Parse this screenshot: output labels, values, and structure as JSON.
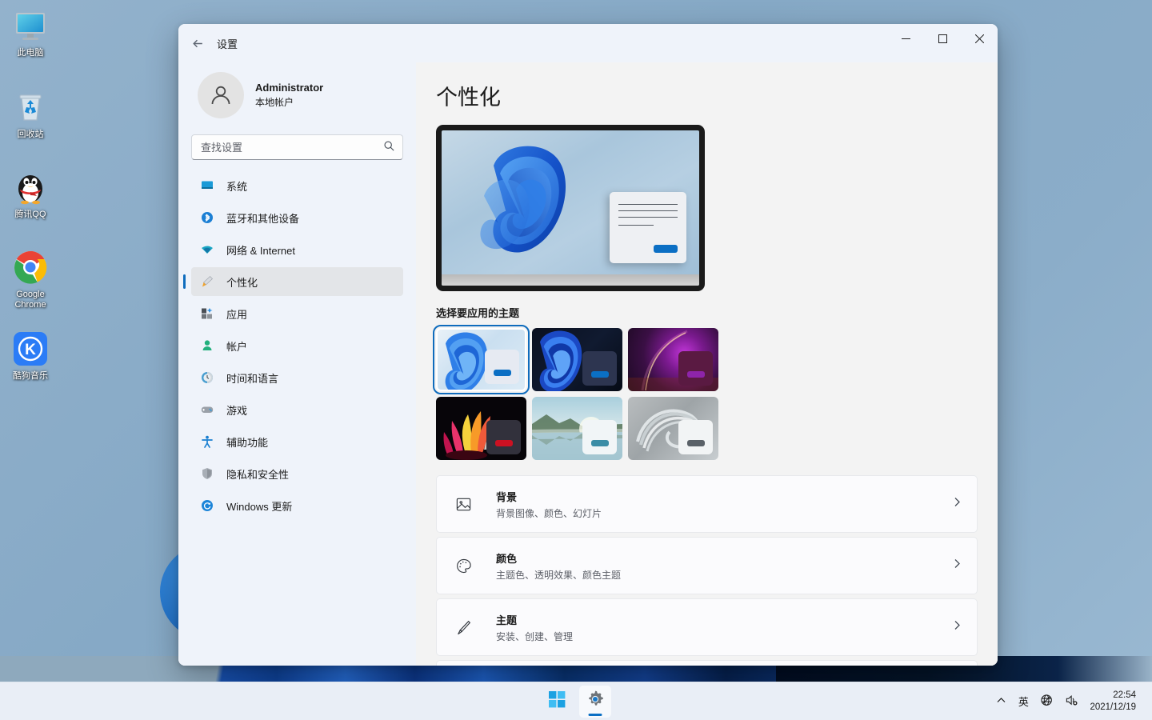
{
  "desktop": {
    "icons": [
      {
        "name": "this-pc",
        "label": "此电脑",
        "icon": "monitor-icon"
      },
      {
        "name": "recycle-bin",
        "label": "回收站",
        "icon": "recycle-bin-icon"
      },
      {
        "name": "tencent-qq",
        "label": "腾讯QQ",
        "icon": "qq-penguin-icon"
      },
      {
        "name": "google-chrome",
        "label": "Google Chrome",
        "icon": "chrome-icon"
      },
      {
        "name": "kugou-music",
        "label": "酷狗音乐",
        "icon": "kugou-k-icon"
      }
    ]
  },
  "window": {
    "title": "设置",
    "back_icon": "back-arrow-icon",
    "controls": {
      "minimize": "–",
      "maximize": "□",
      "close": "✕"
    }
  },
  "sidebar": {
    "account": {
      "name": "Administrator",
      "subtitle": "本地帐户",
      "avatar_icon": "person-avatar-icon"
    },
    "search": {
      "placeholder": "查找设置",
      "value": "",
      "icon": "search-icon"
    },
    "items": [
      {
        "label": "系统",
        "icon": "system-monitor-icon",
        "active": false
      },
      {
        "label": "蓝牙和其他设备",
        "icon": "bluetooth-icon",
        "active": false
      },
      {
        "label": "网络 & Internet",
        "icon": "wifi-icon",
        "active": false
      },
      {
        "label": "个性化",
        "icon": "paintbrush-icon",
        "active": true
      },
      {
        "label": "应用",
        "icon": "apps-icon",
        "active": false
      },
      {
        "label": "帐户",
        "icon": "account-person-icon",
        "active": false
      },
      {
        "label": "时间和语言",
        "icon": "clock-globe-icon",
        "active": false
      },
      {
        "label": "游戏",
        "icon": "gamepad-icon",
        "active": false
      },
      {
        "label": "辅助功能",
        "icon": "accessibility-icon",
        "active": false
      },
      {
        "label": "隐私和安全性",
        "icon": "shield-icon",
        "active": false
      },
      {
        "label": "Windows 更新",
        "icon": "update-refresh-icon",
        "active": false
      }
    ]
  },
  "main": {
    "page_title": "个性化",
    "preview": {
      "name": "desktop-preview-monitor",
      "mini_window_button_color": "#0b6fc4"
    },
    "themes_section_title": "选择要应用的主题",
    "themes": [
      {
        "name": "theme-bloom-light",
        "selected": true,
        "mini_bg": "#e6eaf2",
        "mini_btn": "#0b6fc4"
      },
      {
        "name": "theme-bloom-dark",
        "selected": false,
        "mini_bg": "#2d3550",
        "mini_btn": "#0b6fc4"
      },
      {
        "name": "theme-glow-purple",
        "selected": false,
        "mini_bg": "#5a1a42",
        "mini_btn": "#7b1fa2"
      },
      {
        "name": "theme-flower-dark",
        "selected": false,
        "mini_bg": "#32313c",
        "mini_btn": "#cc1122"
      },
      {
        "name": "theme-captured-lake",
        "selected": false,
        "mini_bg": "#f1f5f7",
        "mini_btn": "#3b8da6"
      },
      {
        "name": "theme-flow-grey",
        "selected": false,
        "mini_bg": "#f2f4f5",
        "mini_btn": "#5a6168"
      }
    ],
    "cards": [
      {
        "name": "background",
        "icon": "image-icon",
        "title": "背景",
        "subtitle": "背景图像、颜色、幻灯片",
        "chevron": "›"
      },
      {
        "name": "colors",
        "icon": "palette-icon",
        "title": "颜色",
        "subtitle": "主题色、透明效果、颜色主题",
        "chevron": "›"
      },
      {
        "name": "themes",
        "icon": "paintbrush-icon",
        "title": "主题",
        "subtitle": "安装、创建、管理",
        "chevron": "›"
      }
    ]
  },
  "taskbar": {
    "start_label": "开始",
    "items": [
      {
        "name": "start-button",
        "icon": "windows-logo-icon",
        "active": false
      },
      {
        "name": "settings-button",
        "icon": "gear-icon",
        "active": true
      }
    ],
    "tray": [
      {
        "name": "show-hidden-icons",
        "icon": "chevron-up-icon",
        "text": "∧"
      },
      {
        "name": "ime-indicator",
        "icon": "ime-icon",
        "text": "英"
      },
      {
        "name": "network-icon",
        "icon": "globe-no-network-icon",
        "text": ""
      },
      {
        "name": "volume-icon",
        "icon": "speaker-muted-icon",
        "text": ""
      }
    ],
    "clock": {
      "time": "22:54",
      "date": "2021/12/19"
    }
  }
}
